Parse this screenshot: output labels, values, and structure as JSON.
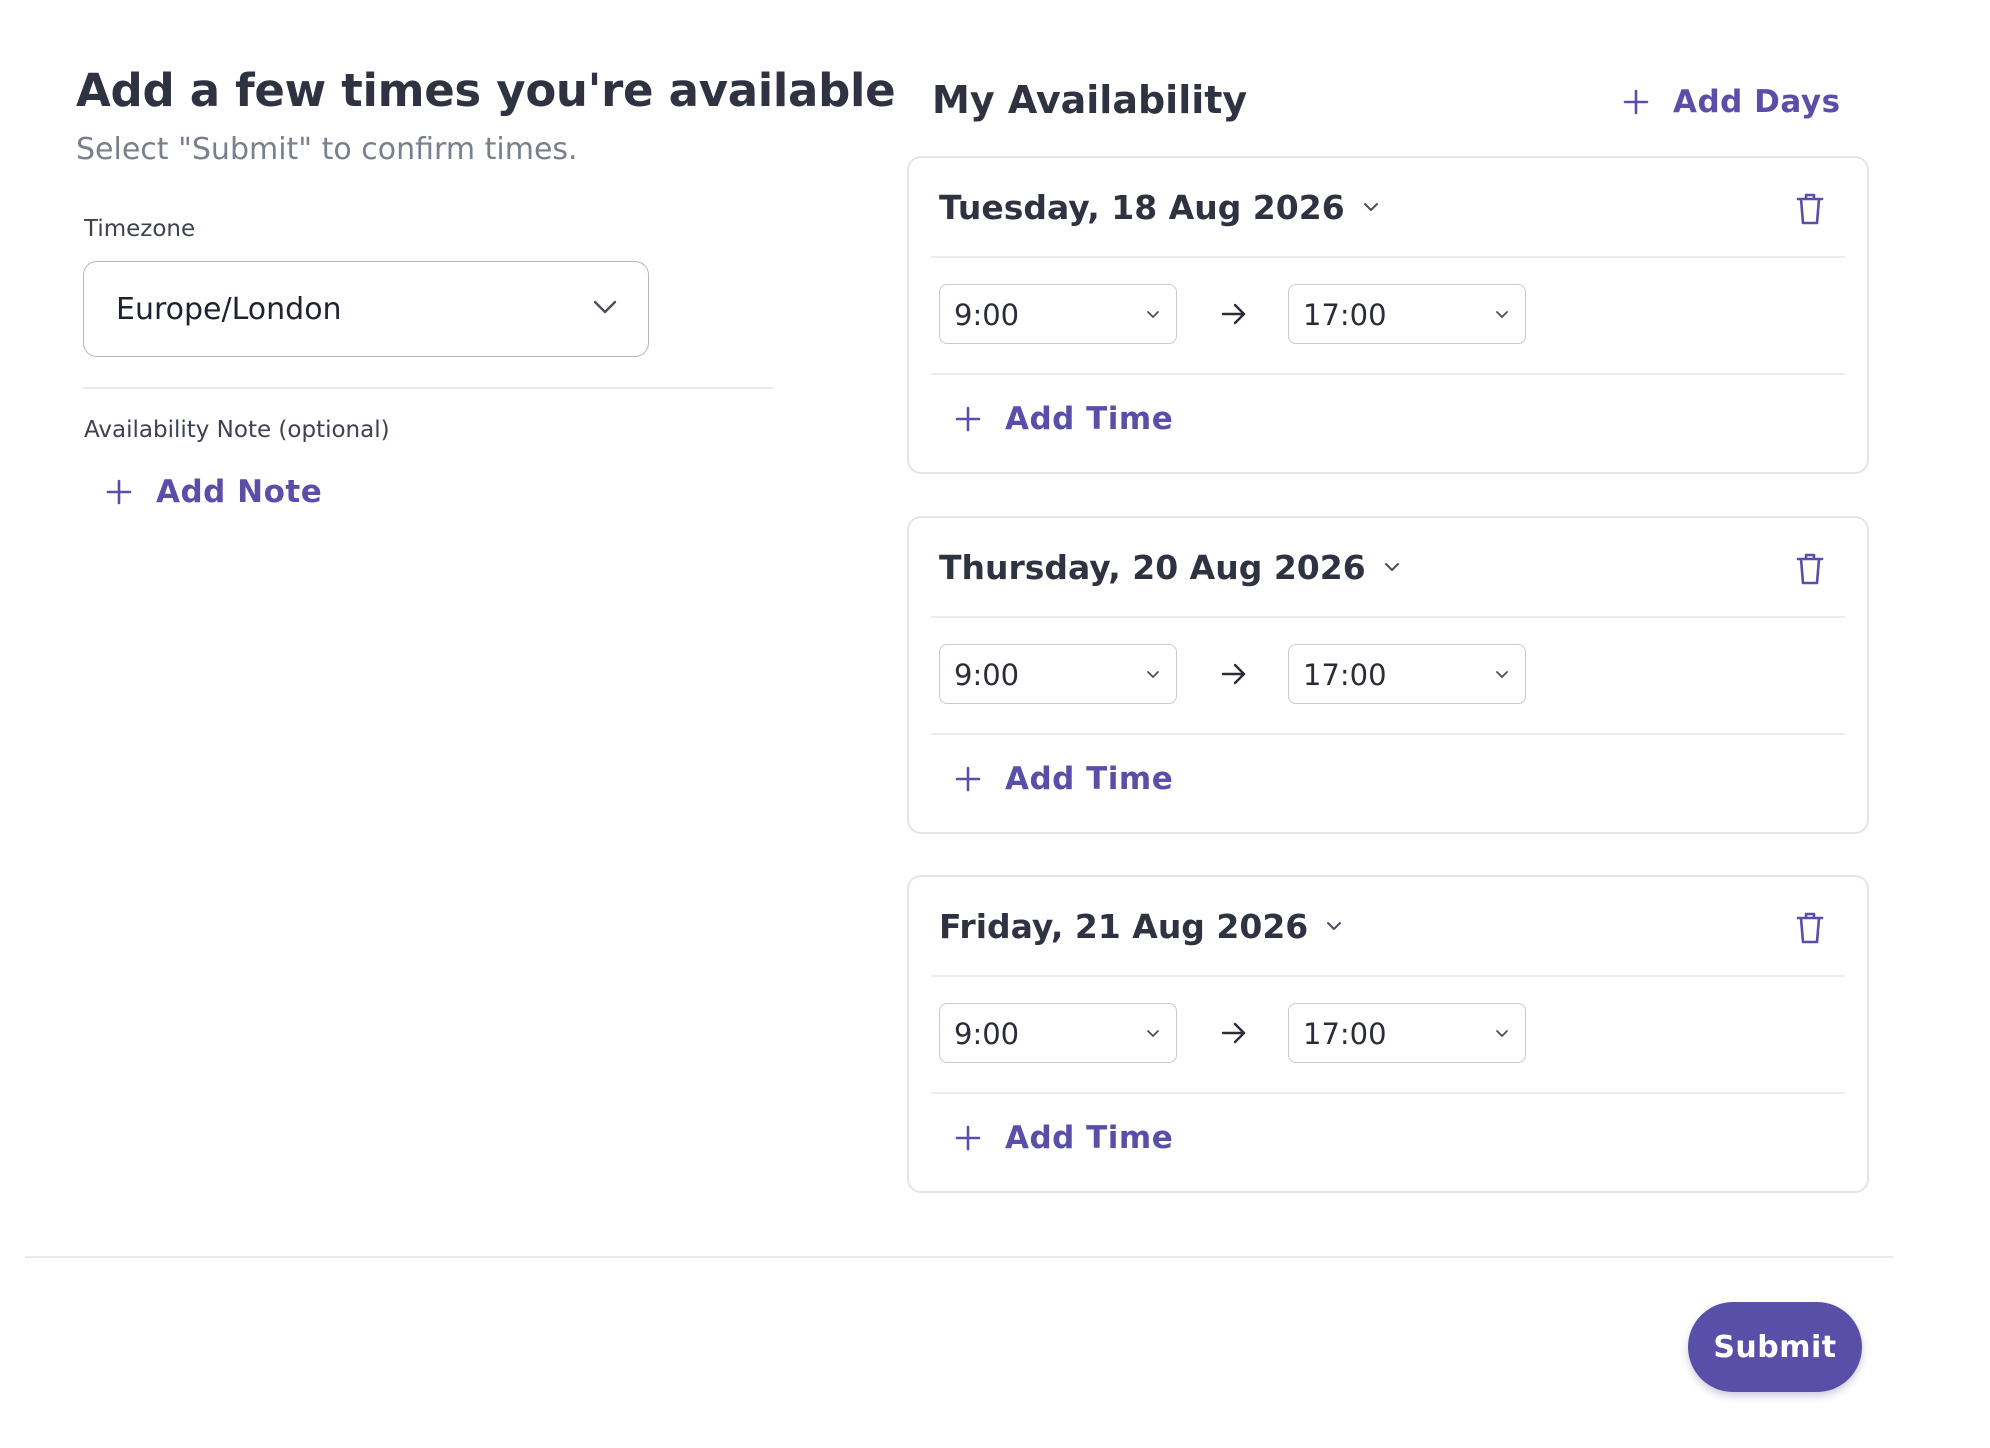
{
  "left": {
    "title": "Add a few times you're available",
    "subtitle": "Select \"Submit\" to confirm times.",
    "timezone": {
      "label": "Timezone",
      "value": "Europe/London",
      "icon": "chevron-down-icon"
    },
    "note": {
      "label": "Availability Note (optional)",
      "add_label": "Add Note",
      "icon": "plus-icon"
    }
  },
  "right": {
    "title": "My Availability",
    "add_days_label": "Add Days",
    "days": [
      {
        "date": "Tuesday, 18 Aug 2026",
        "start": "9:00",
        "end": "17:00",
        "add_time_label": "Add Time"
      },
      {
        "date": "Thursday, 20 Aug 2026",
        "start": "9:00",
        "end": "17:00",
        "add_time_label": "Add Time"
      },
      {
        "date": "Friday, 21 Aug 2026",
        "start": "9:00",
        "end": "17:00",
        "add_time_label": "Add Time"
      }
    ]
  },
  "footer": {
    "submit_label": "Submit"
  },
  "colors": {
    "accent": "#5a4fa8",
    "text_primary": "#2f3341",
    "text_muted": "#7a7f8c",
    "border": "#e4e5ea"
  }
}
